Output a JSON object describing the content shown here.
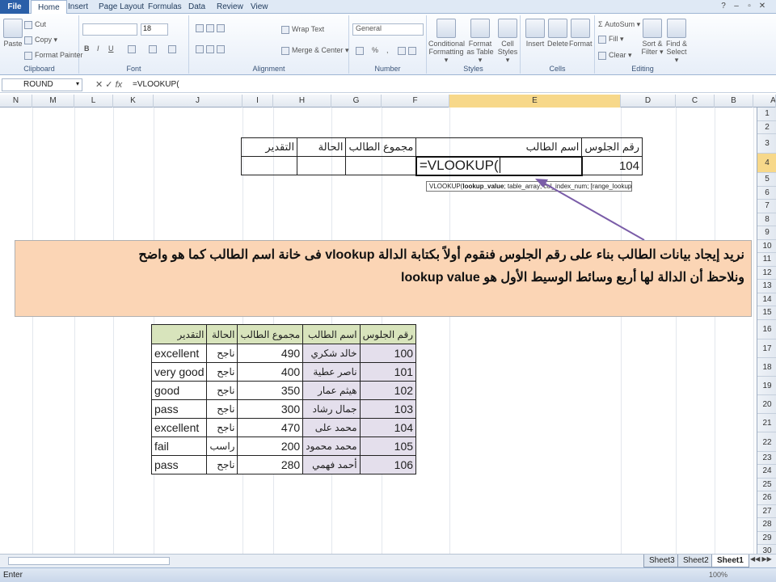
{
  "tabs": {
    "file": "File",
    "home": "Home",
    "insert": "Insert",
    "page_layout": "Page Layout",
    "formulas": "Formulas",
    "data": "Data",
    "review": "Review",
    "view": "View"
  },
  "ribbon": {
    "clipboard": {
      "label": "Clipboard",
      "paste": "Paste",
      "cut": "Cut",
      "copy": "Copy ▾",
      "format_painter": "Format Painter"
    },
    "font": {
      "label": "Font",
      "size": "18",
      "bold": "B",
      "italic": "I",
      "underline": "U"
    },
    "alignment": {
      "label": "Alignment",
      "wrap_text": "Wrap Text",
      "merge_center": "Merge & Center ▾"
    },
    "number": {
      "label": "Number",
      "format": "General",
      "percent": "%",
      "comma": ","
    },
    "styles": {
      "label": "Styles",
      "conditional": "Conditional\nFormatting ▾",
      "format_table": "Format\nas Table ▾",
      "cell_styles": "Cell\nStyles ▾"
    },
    "cells": {
      "label": "Cells",
      "insert": "Insert",
      "delete": "Delete",
      "format": "Format"
    },
    "editing": {
      "label": "Editing",
      "autosum": "Σ AutoSum ▾",
      "fill": "Fill ▾",
      "clear": "Clear ▾",
      "sort_filter": "Sort &\nFilter ▾",
      "find_select": "Find &\nSelect ▾"
    }
  },
  "formula_bar": {
    "name_box": "ROUND",
    "fx": "fx",
    "formula": "=VLOOKUP("
  },
  "columns": [
    "N",
    "M",
    "L",
    "K",
    "J",
    "I",
    "H",
    "G",
    "F",
    "E",
    "D",
    "C",
    "B",
    "A"
  ],
  "rows": [
    "1",
    "2",
    "3",
    "4",
    "5",
    "6",
    "7",
    "8",
    "9",
    "10",
    "11",
    "12",
    "13",
    "14",
    "15",
    "16",
    "17",
    "18",
    "19",
    "20",
    "21",
    "22",
    "23",
    "24",
    "25",
    "26",
    "27",
    "28",
    "29",
    "30"
  ],
  "entry_table": {
    "headers": {
      "seat": "رقم الجلوس",
      "name": "اسم الطالب",
      "total": "مجموع الطالب",
      "status": "الحالة",
      "grade": "التقدير"
    },
    "seat_value": "104",
    "formula_cell": "=VLOOKUP("
  },
  "tooltip": {
    "fn": "VLOOKUP(",
    "arg1": "lookup_value",
    "rest": "; table_array; col_index_num; [range_lookup])"
  },
  "callout": {
    "line1_a": "نريد إيجاد بيانات الطالب بناء على رقم الجلوس فنقوم أولاً بكتابة الدالة ",
    "line1_b": "vlookup",
    "line1_c": " فى خانة اسم الطالب كما هو واضح",
    "line2_a": "ونلاحظ أن الدالة لها أربع وسائط الوسيط الأول هو ",
    "line2_b": "lookup value"
  },
  "data_table": {
    "headers": {
      "seat": "رقم الجلوس",
      "name": "اسم الطالب",
      "total": "مجموع الطالب",
      "status": "الحالة",
      "grade": "التقدير"
    },
    "rows": [
      {
        "seat": "100",
        "name": "خالد شكري",
        "total": "490",
        "status": "ناجح",
        "grade": "excellent"
      },
      {
        "seat": "101",
        "name": "ناصر عطية",
        "total": "400",
        "status": "ناجح",
        "grade": "very good"
      },
      {
        "seat": "102",
        "name": "هيثم عمار",
        "total": "350",
        "status": "ناجح",
        "grade": "good"
      },
      {
        "seat": "103",
        "name": "جمال رشاد",
        "total": "300",
        "status": "ناجح",
        "grade": "pass"
      },
      {
        "seat": "104",
        "name": "محمد على",
        "total": "470",
        "status": "ناجح",
        "grade": "excellent"
      },
      {
        "seat": "105",
        "name": "محمد محمود",
        "total": "200",
        "status": "راسب",
        "grade": "fail"
      },
      {
        "seat": "106",
        "name": "أحمد فهمي",
        "total": "280",
        "status": "ناجح",
        "grade": "pass"
      }
    ]
  },
  "sheets": [
    "Sheet3",
    "Sheet2",
    "Sheet1"
  ],
  "status": {
    "mode": "Enter",
    "zoom": "100%"
  },
  "colors": {
    "accent": "#2a5fa8",
    "header_fill": "#d8e4bc",
    "callout_fill": "#fbd5b5",
    "data_fill": "#e4dfec"
  }
}
